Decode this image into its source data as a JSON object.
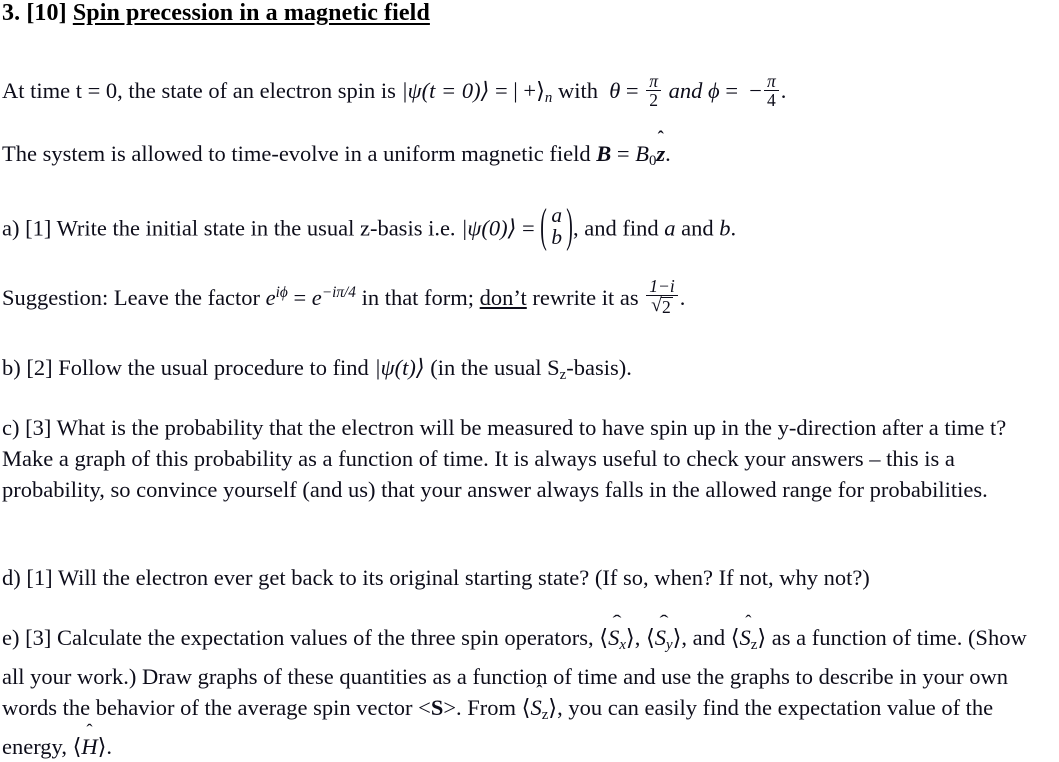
{
  "document": {
    "background_color": "#ffffff",
    "text_color": "#0d0d1a"
  },
  "heading": {
    "number": "3.",
    "points": "[10]",
    "title": "Spin precession in a magnetic field"
  },
  "intro": {
    "line1_a": "At time t = 0, the state of an electron spin is ",
    "psi_t0": "|ψ(t = 0)⟩",
    "equals": " = ",
    "ket_plus_n": "| +⟩",
    "ket_sub": "n",
    "with": " with ",
    "theta": "θ",
    "theta_eq": " = ",
    "theta_num": "π",
    "theta_den": "2",
    "and": "and",
    "phi": "ϕ",
    "phi_eq": " = ",
    "minus": "−",
    "phi_num": "π",
    "phi_den": "4",
    "period": ".",
    "line2_a": "The system is allowed to time-evolve in a uniform magnetic field ",
    "field_B": "B",
    "field_eq": " = ",
    "field_B0": "B",
    "field_B0_sub": "0",
    "field_zhat": "z",
    "field_hat": "̂",
    "line2_end": "."
  },
  "parts": {
    "a": {
      "label": "a)",
      "points": "[1]",
      "text_before": "Write the initial state in the usual z-basis i.e. ",
      "psi0": "|ψ(0)⟩",
      "equals": " = ",
      "vec_top": "a",
      "vec_bottom": "b",
      "text_after": ", and find ",
      "a_sym": "a",
      "and": " and ",
      "b_sym": "b",
      "period": "."
    },
    "suggestion": {
      "lead": "Suggestion: Leave the factor ",
      "e1": "e",
      "e1_sup": "iϕ",
      "equals": " = ",
      "e2": "e",
      "e2_sup": "−iπ/4",
      "middle": " in that form; ",
      "dont": "don’t",
      "after": " rewrite it as ",
      "frac_num": "1−i",
      "frac_den_radicand": "2",
      "period": "."
    },
    "b": {
      "label": "b)",
      "points": "[2]",
      "text_before": "Follow the usual procedure to find ",
      "psi_t": "|ψ(t)⟩",
      "text_mid": " (in the usual S",
      "s_sub": "z",
      "text_after": "-basis)."
    },
    "c": {
      "label": "c)",
      "points": "[3]",
      "text": "What is the probability that the electron will be measured to have spin up in the y-direction after a time t? Make a graph of this probability as a function of time. It is always useful to check your answers – this is a probability, so convince yourself (and us) that your answer always falls in the allowed range for probabilities."
    },
    "d": {
      "label": "d)",
      "points": "[1]",
      "text": "Will the electron ever get back to its original starting state? (If so, when? If not, why not?)"
    },
    "e": {
      "label": "e)",
      "points": "[3]",
      "text_before": "Calculate the expectation values of the three spin operators, ",
      "op_S": "S",
      "hat_glyph": "̂",
      "sub_x": "x",
      "sub_y": "y",
      "sub_z": "z",
      "sep1": ", ",
      "sep2": ", and ",
      "text_mid": " as a function of time. (Show all your work.) Draw graphs of these quantities as a function of time and use the graphs to describe in your own words the behavior of the average spin vector ",
      "avg_spin_open": "<",
      "avg_spin_S": "S",
      "avg_spin_close": ">",
      "text_after": ".  From ",
      "text_tail": ", you can easily find the expectation value of the energy, ",
      "op_H": "H",
      "period": "."
    }
  },
  "glyphs": {
    "angle_open": "⟨",
    "angle_close": "⟩",
    "paren_open": "(",
    "paren_close": ")",
    "radical": "√"
  }
}
